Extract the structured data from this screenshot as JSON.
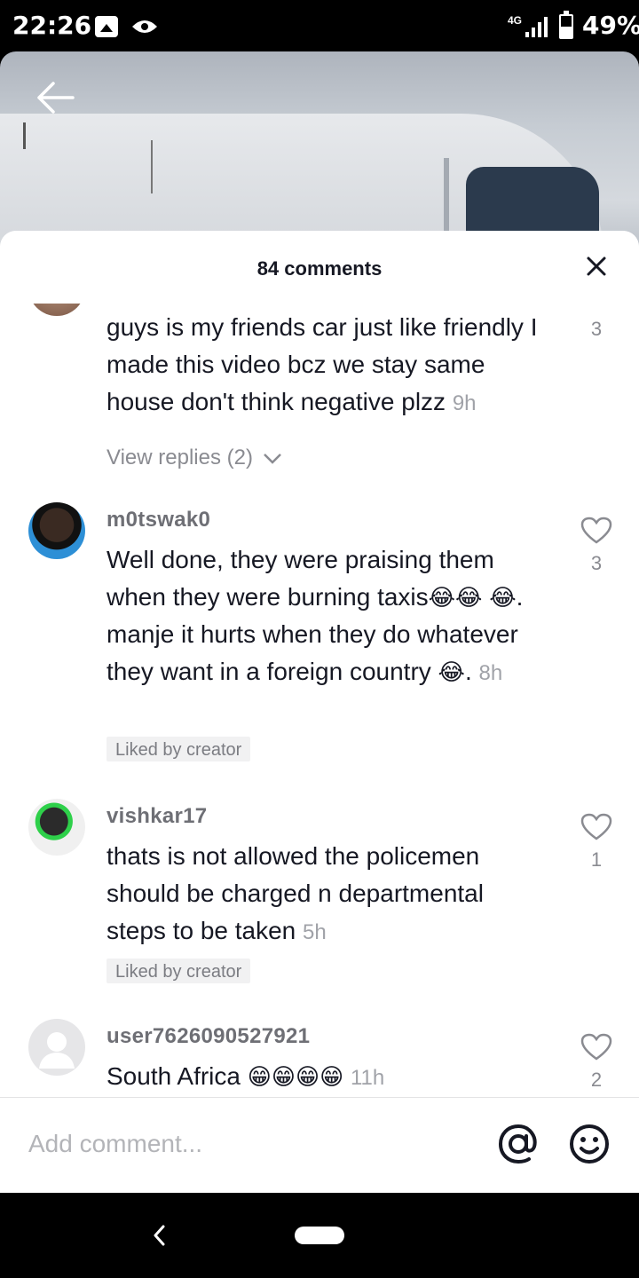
{
  "status_bar": {
    "time": "22:26",
    "network": "4G",
    "battery": "49%",
    "icons": [
      "image-icon",
      "eye-icon",
      "signal-icon",
      "battery-icon"
    ]
  },
  "video": {
    "back_icon": "arrow-left-icon"
  },
  "sheet": {
    "title": "84 comments",
    "close_icon": "close-icon"
  },
  "comments": [
    {
      "username": "",
      "text": "guys is my friends car just like friendly I made this video bcz we stay same house don't think negative plzz",
      "time": "9h",
      "likes": "3",
      "view_replies": "View replies (2)"
    },
    {
      "username": "m0tswak0",
      "text_parts": [
        "Well done, they were praising them when they were burning taxis",
        "😂",
        "😂",
        "😂",
        ". manje it hurts when they do whatever they want in a foreign country ",
        "😂",
        "."
      ],
      "time": "8h",
      "likes": "3",
      "badge": "Liked by creator"
    },
    {
      "username": "vishkar17",
      "text": "thats is not allowed the policemen should be charged n departmental steps to be taken",
      "time": "5h",
      "likes": "1",
      "badge": "Liked by creator"
    },
    {
      "username": "user7626090527921",
      "text": "South Africa",
      "emojis": "😁😁😁😁",
      "time": "11h",
      "likes": "2"
    }
  ],
  "input": {
    "placeholder": "Add comment...",
    "mention_icon": "at-icon",
    "emoji_icon": "emoji-icon"
  },
  "nav": {
    "back_icon": "nav-back-icon",
    "home_icon": "nav-home-pill"
  },
  "colors": {
    "text": "#161823",
    "muted": "#8a8b91",
    "badge_bg": "#f1f1f2"
  }
}
